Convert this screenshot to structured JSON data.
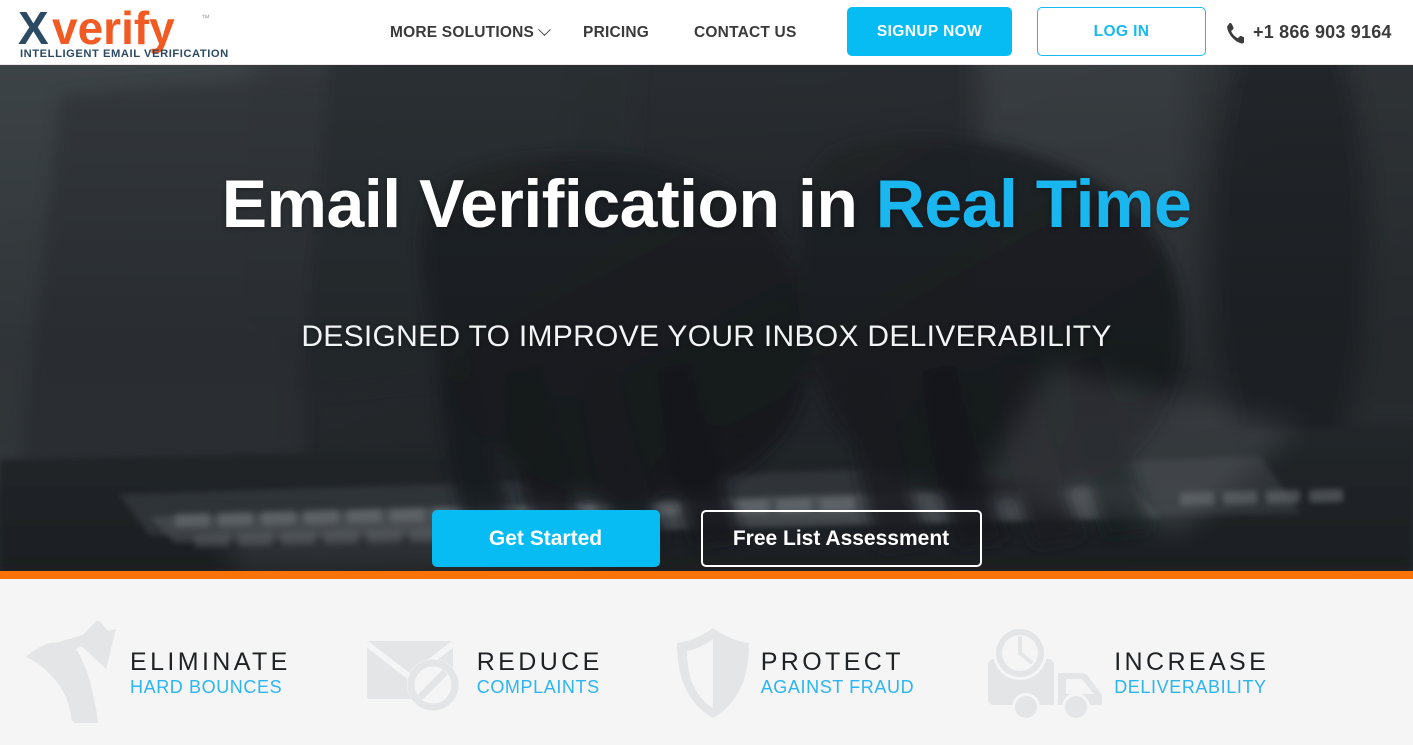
{
  "brand": {
    "name": "Xverify",
    "name_x": "X",
    "name_rest": "verify",
    "tagline": "INTELLIGENT EMAIL VERIFICATION",
    "trademark": "™",
    "color_dark": "#2C4A63",
    "color_orange": "#F15A22"
  },
  "header": {
    "nav": [
      {
        "label": "MORE SOLUTIONS",
        "has_dropdown": true
      },
      {
        "label": "PRICING",
        "has_dropdown": false
      },
      {
        "label": "CONTACT US",
        "has_dropdown": false
      }
    ],
    "signup_label": "SIGNUP NOW",
    "login_label": "LOG IN",
    "phone": "+1 866 903 9164",
    "phone_icon": "phone-icon",
    "accent_color": "#06BCF2"
  },
  "hero": {
    "title_part1": "Email Verification in ",
    "title_accent": "Real Time",
    "subtitle": "DESIGNED TO IMPROVE YOUR INBOX DELIVERABILITY",
    "cta_primary": "Get Started",
    "cta_secondary": "Free List Assessment",
    "accent_color": "#19B6F0",
    "background": "dark grayscale photo of hands typing on a laptop keyboard"
  },
  "divider": {
    "color": "#F97309"
  },
  "features": [
    {
      "icon": "curved-up-arrow-icon",
      "title": "ELIMINATE",
      "subtitle": "HARD BOUNCES"
    },
    {
      "icon": "envelope-blocked-icon",
      "title": "REDUCE",
      "subtitle": "COMPLAINTS"
    },
    {
      "icon": "shield-icon",
      "title": "PROTECT",
      "subtitle": "AGAINST FRAUD"
    },
    {
      "icon": "truck-clock-icon",
      "title": "INCREASE",
      "subtitle": "DELIVERABILITY"
    }
  ],
  "feature_colors": {
    "title": "#1e2224",
    "subtitle": "#2BB6F2",
    "icon": "#e2e4e6"
  }
}
